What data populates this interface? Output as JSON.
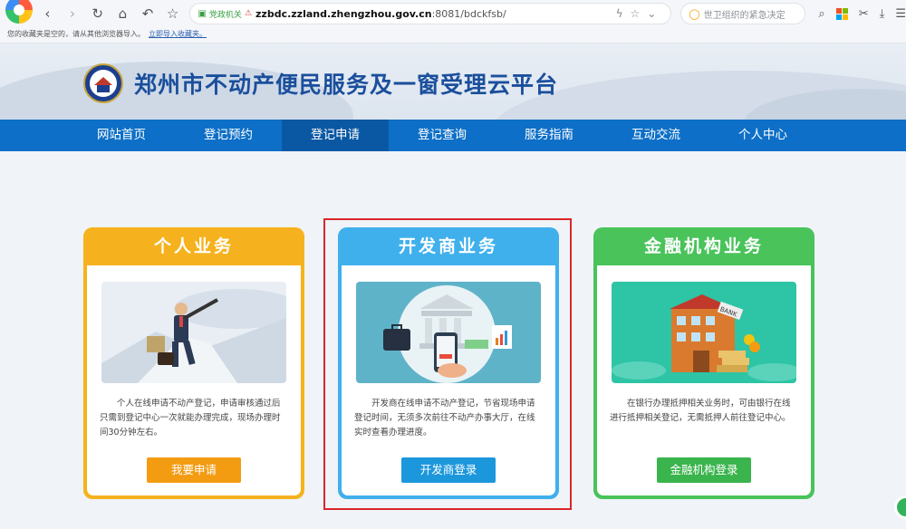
{
  "browser": {
    "address": {
      "badge_gov": "党政机关",
      "badge_warn": "",
      "host": "zzbdc.zzland.zhengzhou.gov.cn",
      "path": ":8081/bdckfsb/"
    },
    "search_placeholder": "世卫组织的紧急决定",
    "bookmark_bar": {
      "message": "您的收藏夹是空的，请从其他浏览器导入。",
      "import_link": "立即导入收藏夹。"
    }
  },
  "site": {
    "title": "郑州市不动产便民服务及一窗受理云平台"
  },
  "nav": {
    "items": [
      {
        "label": "网站首页"
      },
      {
        "label": "登记预约"
      },
      {
        "label": "登记申请"
      },
      {
        "label": "登记查询"
      },
      {
        "label": "服务指南"
      },
      {
        "label": "互动交流"
      },
      {
        "label": "个人中心"
      }
    ],
    "active_index": 2
  },
  "cards": {
    "personal": {
      "title": "个人业务",
      "description": "个人在线申请不动产登记，申请审核通过后只需到登记中心一次就能办理完成，现场办理时间30分钟左右。",
      "button": "我要申请"
    },
    "developer": {
      "title": "开发商业务",
      "description": "开发商在线申请不动产登记，节省现场申请登记时间，无须多次前往不动产办事大厅，在线实时查看办理进度。",
      "button": "开发商登录"
    },
    "finance": {
      "title": "金融机构业务",
      "description": "在银行办理抵押相关业务时，可由银行在线进行抵押相关登记，无需抵押人前往登记中心。",
      "button": "金融机构登录",
      "bank_sign": "BANK"
    }
  },
  "colors": {
    "nav_blue": "#0d6fc7",
    "personal": "#f6b21e",
    "developer": "#3fb0ec",
    "finance": "#49c35a",
    "highlight": "#d9262b"
  }
}
